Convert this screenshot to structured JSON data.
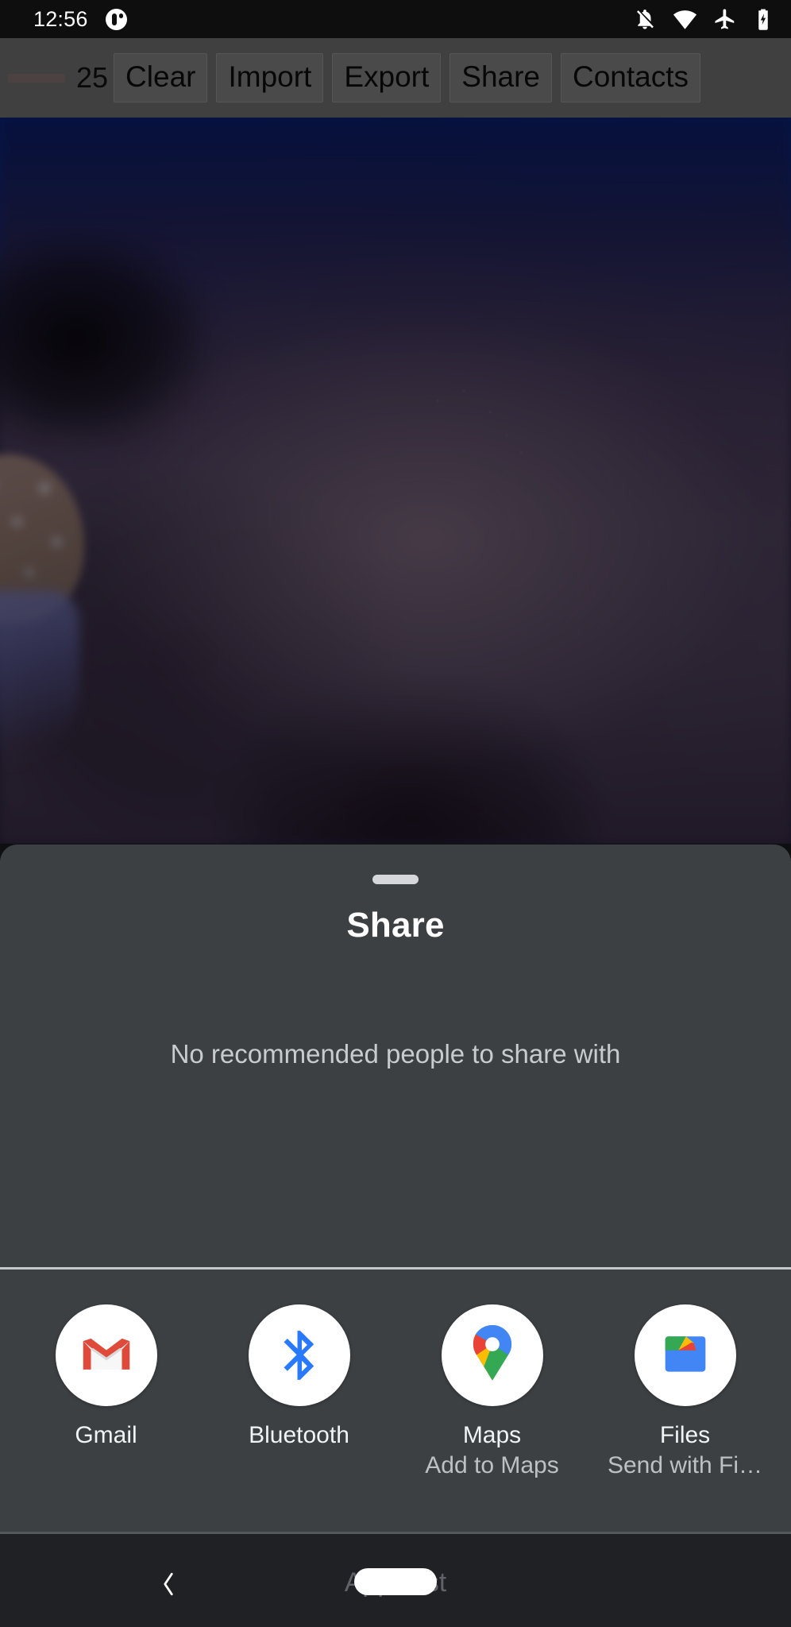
{
  "status_bar": {
    "time": "12:56",
    "left_icons": [
      {
        "name": "notification-badge-icon",
        "glyph": "circle-notification"
      }
    ],
    "right_icons": [
      {
        "name": "notifications-silenced-icon",
        "glyph": "bell-off"
      },
      {
        "name": "wifi-icon",
        "glyph": "wifi"
      },
      {
        "name": "airplane-mode-icon",
        "glyph": "airplane"
      },
      {
        "name": "battery-charging-icon",
        "glyph": "battery-charging"
      }
    ]
  },
  "app_toolbar": {
    "count": "25",
    "buttons": [
      {
        "label": "Clear"
      },
      {
        "label": "Import"
      },
      {
        "label": "Export"
      },
      {
        "label": "Share"
      },
      {
        "label": "Contacts"
      }
    ]
  },
  "share_sheet": {
    "title": "Share",
    "empty_recommendations": "No recommended people to share with",
    "apps": [
      {
        "label": "Gmail",
        "subtitle": "",
        "icon": "gmail-icon"
      },
      {
        "label": "Bluetooth",
        "subtitle": "",
        "icon": "bluetooth-icon"
      },
      {
        "label": "Maps",
        "subtitle": "Add to Maps",
        "icon": "google-maps-icon"
      },
      {
        "label": "Files",
        "subtitle": "Send with Fi…",
        "icon": "google-files-icon"
      }
    ]
  },
  "nav_bar": {
    "back_label": "",
    "apps_list_label": "Apps list"
  },
  "colors": {
    "sheet_background": "#3c4043",
    "status_bar_background": "#0e0e0e",
    "nav_bar_background": "#202124",
    "toolbar_background": "#757575",
    "accent_white": "#ffffff",
    "secondary_text": "#bdc1c4",
    "gmail_red": "#ea4335",
    "bluetooth_blue": "#2979ff",
    "maps_blue": "#4285f4",
    "maps_red": "#ea4335",
    "maps_yellow": "#fbbc04",
    "maps_green": "#34a853",
    "divider": "#c6c9cb"
  }
}
